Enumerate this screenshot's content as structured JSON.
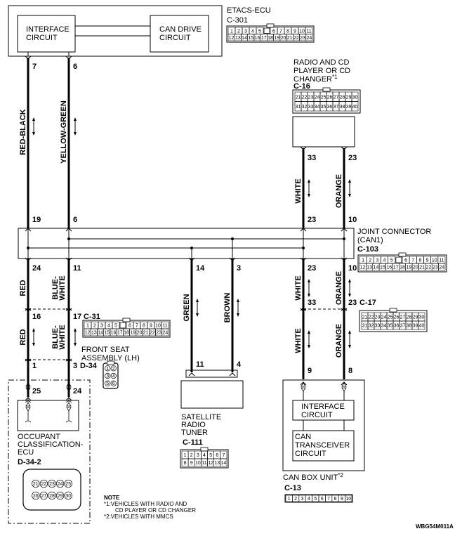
{
  "etacs": {
    "name": "ETACS-ECU",
    "connector": "C-301",
    "interface": [
      "INTERFACE",
      "CIRCUIT"
    ],
    "can_drive": [
      "CAN DRIVE",
      "CIRCUIT"
    ],
    "pins": [
      "7",
      "6"
    ]
  },
  "radio": {
    "name": [
      "RADIO AND CD",
      "PLAYER OR CD",
      "CHANGER"
    ],
    "note_mark": "*1",
    "connector": "C-16",
    "pins_top": [
      "33",
      "23"
    ],
    "pins_bottom": [
      "23",
      "10"
    ]
  },
  "joint": {
    "name": [
      "JOINT CONNECTOR",
      "(CAN1)"
    ],
    "connector": "C-103",
    "pins_top": [
      "19",
      "6"
    ],
    "pins_bottom": [
      "24",
      "11",
      "14",
      "3",
      "23",
      "10"
    ]
  },
  "wires": {
    "red_black": "RED-BLACK",
    "yellow_green": "YELLOW-GREEN",
    "white": "WHITE",
    "orange": "ORANGE",
    "red": "RED",
    "blue_white": [
      "BLUE-",
      "WHITE"
    ],
    "green": "GREEN",
    "brown": "BROWN"
  },
  "c31": {
    "connector": "C-31",
    "pins": [
      "16",
      "17"
    ]
  },
  "front_seat": {
    "name": [
      "FRONT SEAT",
      "ASSEMBLY (LH)"
    ],
    "connector": "D-34",
    "pins": [
      "1",
      "3"
    ]
  },
  "occupant": {
    "name": [
      "OCCUPANT",
      "CLASSIFICATION-",
      "ECU"
    ],
    "connector": "D-34-2",
    "pins": [
      "25",
      "24"
    ]
  },
  "satellite": {
    "name": [
      "SATELLITE",
      "RADIO",
      "TUNER"
    ],
    "connector": "C-111",
    "pins": [
      "11",
      "4"
    ]
  },
  "c17": {
    "connector": "C-17",
    "pins": [
      "33",
      "23"
    ]
  },
  "can_box": {
    "name": "CAN BOX UNIT",
    "note_mark": "*2",
    "connector": "C-13",
    "pins": [
      "9",
      "8"
    ],
    "interface": [
      "INTERFACE",
      "CIRCUIT"
    ],
    "transceiver": [
      "CAN",
      "TRANSCEIVER",
      "CIRCUIT"
    ]
  },
  "note": {
    "title": "NOTE",
    "lines": [
      "*1:VEHICLES WITH RADIO AND",
      "CD PLAYER OR CD CHANGER",
      "*2:VEHICLES WITH MMCS"
    ]
  },
  "figure_code": "WBG54M011A",
  "connector_faces": {
    "c301": [
      [
        "1",
        "2",
        "3",
        "4",
        "5",
        "6",
        "7",
        "8",
        "9",
        "10",
        "11"
      ],
      [
        "12",
        "13",
        "14",
        "15",
        "16",
        "17",
        "18",
        "19",
        "20",
        "21",
        "22",
        "23",
        "24"
      ]
    ],
    "c16": [
      [
        "21",
        "22",
        "23",
        "24",
        "25",
        "26",
        "27",
        "28",
        "29",
        "30"
      ],
      [
        "31",
        "32",
        "33",
        "34",
        "35",
        "36",
        "37",
        "38",
        "39",
        "40"
      ]
    ],
    "c103": [
      [
        "1",
        "2",
        "3",
        "4",
        "5",
        "6",
        "7",
        "8",
        "9",
        "10",
        "11"
      ],
      [
        "12",
        "13",
        "14",
        "15",
        "16",
        "17",
        "18",
        "19",
        "20",
        "21",
        "22",
        "23",
        "24"
      ]
    ],
    "c31": [
      [
        "1",
        "2",
        "3",
        "4",
        "5",
        "6",
        "7",
        "8",
        "9",
        "10",
        "11"
      ],
      [
        "12",
        "13",
        "14",
        "15",
        "16",
        "17",
        "18",
        "19",
        "20",
        "21",
        "22",
        "23",
        "24"
      ]
    ],
    "c17": [
      [
        "21",
        "22",
        "23",
        "24",
        "25",
        "26",
        "27",
        "28",
        "29",
        "30"
      ],
      [
        "31",
        "32",
        "33",
        "34",
        "35",
        "36",
        "37",
        "38",
        "39",
        "40"
      ]
    ],
    "c111": [
      [
        "1",
        "2",
        "3",
        "4",
        "5",
        "6",
        "7"
      ],
      [
        "8",
        "9",
        "10",
        "11",
        "12",
        "13",
        "14"
      ]
    ],
    "c13": [
      [
        "1",
        "2",
        "3",
        "4",
        "5",
        "6",
        "7",
        "8",
        "9",
        "10"
      ]
    ],
    "d34": [
      [
        "1",
        "2"
      ],
      [
        "3",
        "4"
      ],
      [
        "5",
        "6"
      ]
    ],
    "d342": [
      [
        "21",
        "22",
        "23",
        "24",
        "25"
      ],
      [
        "26",
        "27",
        "28",
        "29",
        "30"
      ]
    ]
  }
}
